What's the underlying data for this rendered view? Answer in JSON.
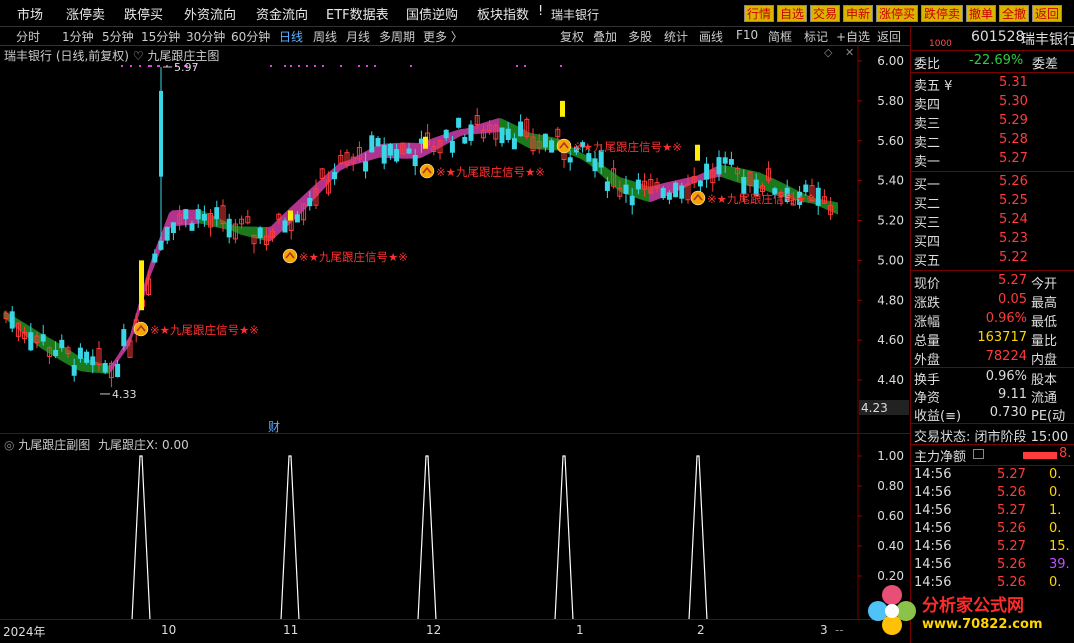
{
  "topbar": {
    "menus": [
      "市场",
      "涨停卖",
      "跌停买",
      "外资流向",
      "资金流向",
      "ETF数据表",
      "国债逆购",
      "板块指数"
    ],
    "warn": "!",
    "stock_name": "瑞丰银行",
    "buttons": [
      "行情",
      "自选",
      "交易",
      "申新",
      "涨停买",
      "跌停卖",
      "撤单",
      "全撤",
      "返回"
    ]
  },
  "toolbar": {
    "periods": [
      "分时",
      "1分钟",
      "5分钟",
      "15分钟",
      "30分钟",
      "60分钟",
      "日线",
      "周线",
      "月线",
      "多周期",
      "更多 〉"
    ],
    "tools": [
      "复权",
      "叠加",
      "多股",
      "统计",
      "画线",
      "F10",
      "简框",
      "标记",
      "+自选",
      "返回"
    ]
  },
  "main_chart": {
    "title": "瑞丰银行 (日线,前复权) ♡ 九尾跟庄主图",
    "y_ticks": [
      "6.00",
      "5.80",
      "5.60",
      "5.40",
      "5.20",
      "5.00",
      "4.80",
      "4.60",
      "4.40"
    ],
    "y_label_bottom": "4.23",
    "high_label": "5.97",
    "low_label": "4.33",
    "signal_text": "※★九尾跟庄信号★※",
    "cai_label": "财"
  },
  "sub_chart": {
    "title": "九尾跟庄副图",
    "indicator": "九尾跟庄X: 0.00",
    "y_ticks": [
      "1.00",
      "0.80",
      "0.60",
      "0.40",
      "0.20"
    ]
  },
  "xaxis": {
    "labels": [
      "2024年",
      "10",
      "11",
      "12",
      "1",
      "2",
      "3"
    ],
    "end": "--"
  },
  "quote": {
    "code_prefix": "1000",
    "code": "601528",
    "name": "瑞丰银行",
    "webi_label": "委比",
    "webi_value": "-22.69%",
    "weicha_label": "委差",
    "sells": [
      {
        "label": "卖五 ¥",
        "price": "5.31"
      },
      {
        "label": "卖四",
        "price": "5.30"
      },
      {
        "label": "卖三",
        "price": "5.29"
      },
      {
        "label": "卖二",
        "price": "5.28"
      },
      {
        "label": "卖一",
        "price": "5.27"
      }
    ],
    "buys": [
      {
        "label": "买一",
        "price": "5.26"
      },
      {
        "label": "买二",
        "price": "5.25"
      },
      {
        "label": "买三",
        "price": "5.24"
      },
      {
        "label": "买四",
        "price": "5.23"
      },
      {
        "label": "买五",
        "price": "5.22"
      }
    ],
    "stats": [
      {
        "label": "现价",
        "value": "5.27",
        "tail": "今开",
        "cls": "red"
      },
      {
        "label": "涨跌",
        "value": "0.05",
        "tail": "最高",
        "cls": "red"
      },
      {
        "label": "涨幅",
        "value": "0.96%",
        "tail": "最低",
        "cls": "red"
      },
      {
        "label": "总量",
        "value": "163717",
        "tail": "量比",
        "cls": "yellow"
      },
      {
        "label": "外盘",
        "value": "78224",
        "tail": "内盘",
        "cls": "red"
      }
    ],
    "stats2": [
      {
        "label": "换手",
        "value": "0.96%",
        "tail": "股本"
      },
      {
        "label": "净资",
        "value": "9.11",
        "tail": "流通"
      },
      {
        "label": "收益(≡)",
        "value": "0.730",
        "tail": "PE(动"
      }
    ],
    "trade_status": "交易状态: 闭市阶段 15:00",
    "main_net_label": "主力净额",
    "main_net_value": "8.",
    "ticks": [
      {
        "time": "14:56",
        "price": "5.27",
        "vol": "0.",
        "cls": "red",
        "vcls": "yellow"
      },
      {
        "time": "14:56",
        "price": "5.26",
        "vol": "0.",
        "cls": "red",
        "vcls": "yellow"
      },
      {
        "time": "14:56",
        "price": "5.27",
        "vol": "1.",
        "cls": "red",
        "vcls": "yellow"
      },
      {
        "time": "14:56",
        "price": "5.26",
        "vol": "0.",
        "cls": "red",
        "vcls": "yellow"
      },
      {
        "time": "14:56",
        "price": "5.27",
        "vol": "15.",
        "cls": "red",
        "vcls": "yellow"
      },
      {
        "time": "14:56",
        "price": "5.26",
        "vol": "39.",
        "cls": "red",
        "vcls": "purple"
      },
      {
        "time": "14:56",
        "price": "5.26",
        "vol": "0.",
        "cls": "red",
        "vcls": "yellow"
      }
    ]
  },
  "watermark": {
    "title": "分析家公式网",
    "url": "www.70822.com"
  },
  "colors": {
    "up": "#ff3b3b",
    "down": "#3ad6e6",
    "band_up": "#b0338f",
    "band_down": "#1b7a1b",
    "signal_yellow": "#ffee00"
  }
}
